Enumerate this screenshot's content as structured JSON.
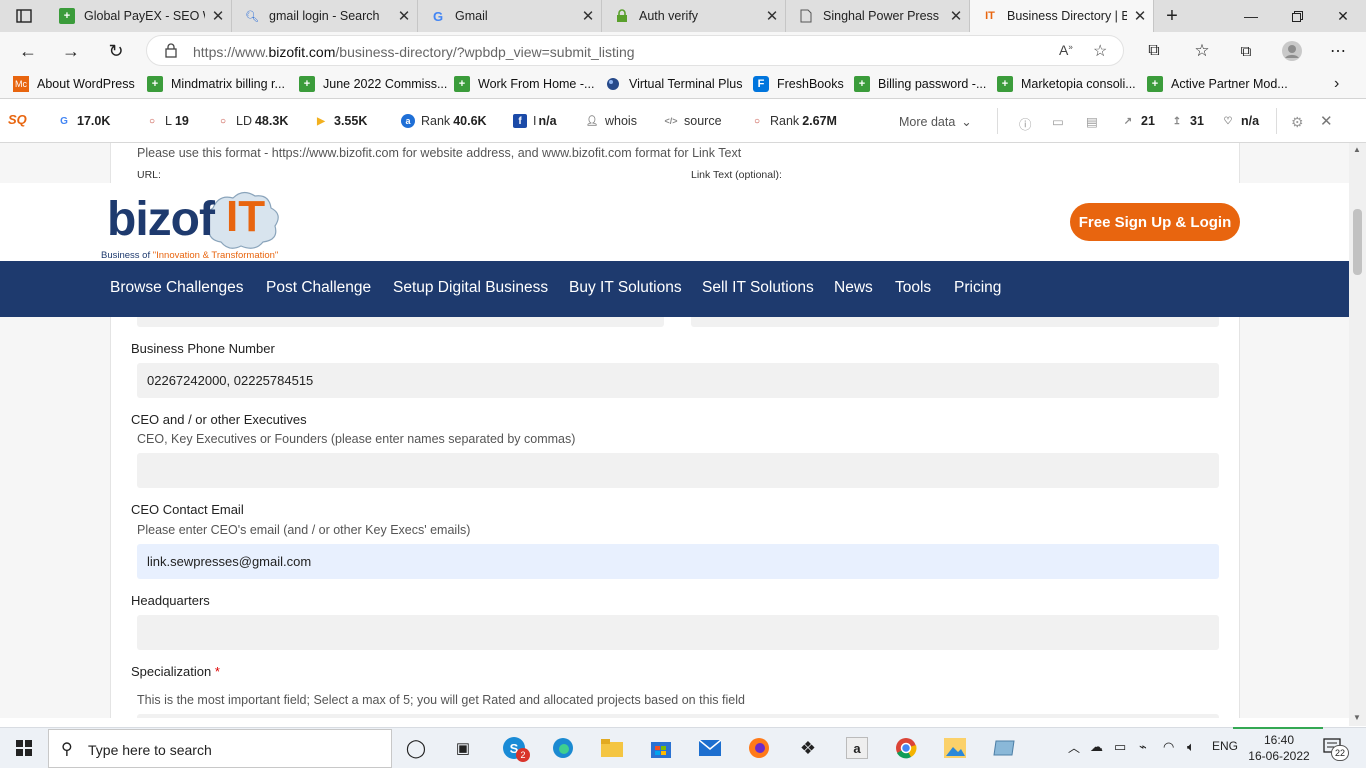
{
  "tabs": [
    {
      "title": "Global PayEX - SEO W",
      "icon": "sheets-icon"
    },
    {
      "title": "gmail login - Search",
      "icon": "search-icon"
    },
    {
      "title": "Gmail",
      "icon": "google-icon"
    },
    {
      "title": "Auth verify",
      "icon": "lock-icon"
    },
    {
      "title": "Singhal Power Press M",
      "icon": "document-icon"
    },
    {
      "title": "Business Directory | Bi",
      "icon": "bizofit-icon"
    }
  ],
  "address": {
    "url_prefix": "https://www.",
    "url_domain": "bizofit.com",
    "url_path": "/business-directory/?wpbdp_view=submit_listing"
  },
  "bookmarks": [
    "About WordPress",
    "Mindmatrix billing r...",
    "June 2022 Commiss...",
    "Work From Home -...",
    "Virtual Terminal Plus",
    "FreshBooks",
    "Billing password -...",
    "Marketopia consoli...",
    "Active Partner Mod..."
  ],
  "seo": {
    "g": "17.0K",
    "l": "19",
    "ld": "48.3K",
    "i": "3.55K",
    "rank1": "40.6K",
    "fb": "n/a",
    "whois": "whois",
    "source": "source",
    "rank2": "2.67M",
    "more": "More data",
    "count1": "21",
    "count2": "31",
    "heart": "n/a",
    "l_prefix": "L",
    "ld_prefix": "LD",
    "rank_prefix": "Rank",
    "fb_prefix": "I"
  },
  "form": {
    "url_hint": "Please use this format - https://www.bizofit.com for website address, and www.bizofit.com format for Link Text",
    "url_label": "URL:",
    "linktext_label": "Link Text (optional):",
    "phone_label": "Business Phone Number",
    "phone_value": "02267242000, 02225784515",
    "ceo_label": "CEO and / or other Executives",
    "ceo_hint": "CEO, Key Executives or Founders (please enter names separated by commas)",
    "ceo_value": "",
    "email_label": "CEO Contact Email",
    "email_hint": "Please enter CEO's email (and / or other Key Execs' emails)",
    "email_value": "link.sewpresses@gmail.com",
    "hq_label": "Headquarters",
    "hq_value": "",
    "spec_label": "Specialization",
    "spec_required": "*",
    "spec_hint": "This is the most important field; Select a max of 5; you will get Rated and allocated projects based on this field"
  },
  "site": {
    "logo_text_dark": "bizof",
    "logo_text_it": "IT",
    "tagline_prefix": "Business of ",
    "tagline_quote": "\"Innovation & Transformation\"",
    "signup": "Free Sign Up & Login",
    "nav": [
      "Browse Challenges",
      "Post Challenge",
      "Setup Digital Business",
      "Buy IT Solutions",
      "Sell IT Solutions",
      "News",
      "Tools",
      "Pricing"
    ]
  },
  "taskbar": {
    "search_placeholder": "Type here to search",
    "lang": "ENG",
    "time": "16:40",
    "date": "16-06-2022",
    "notif_count": "22",
    "skype_badge": "2"
  },
  "colors": {
    "brand_orange": "#e8650f",
    "nav_blue": "#1e3a6e",
    "email_field": "#e8f0fe"
  }
}
